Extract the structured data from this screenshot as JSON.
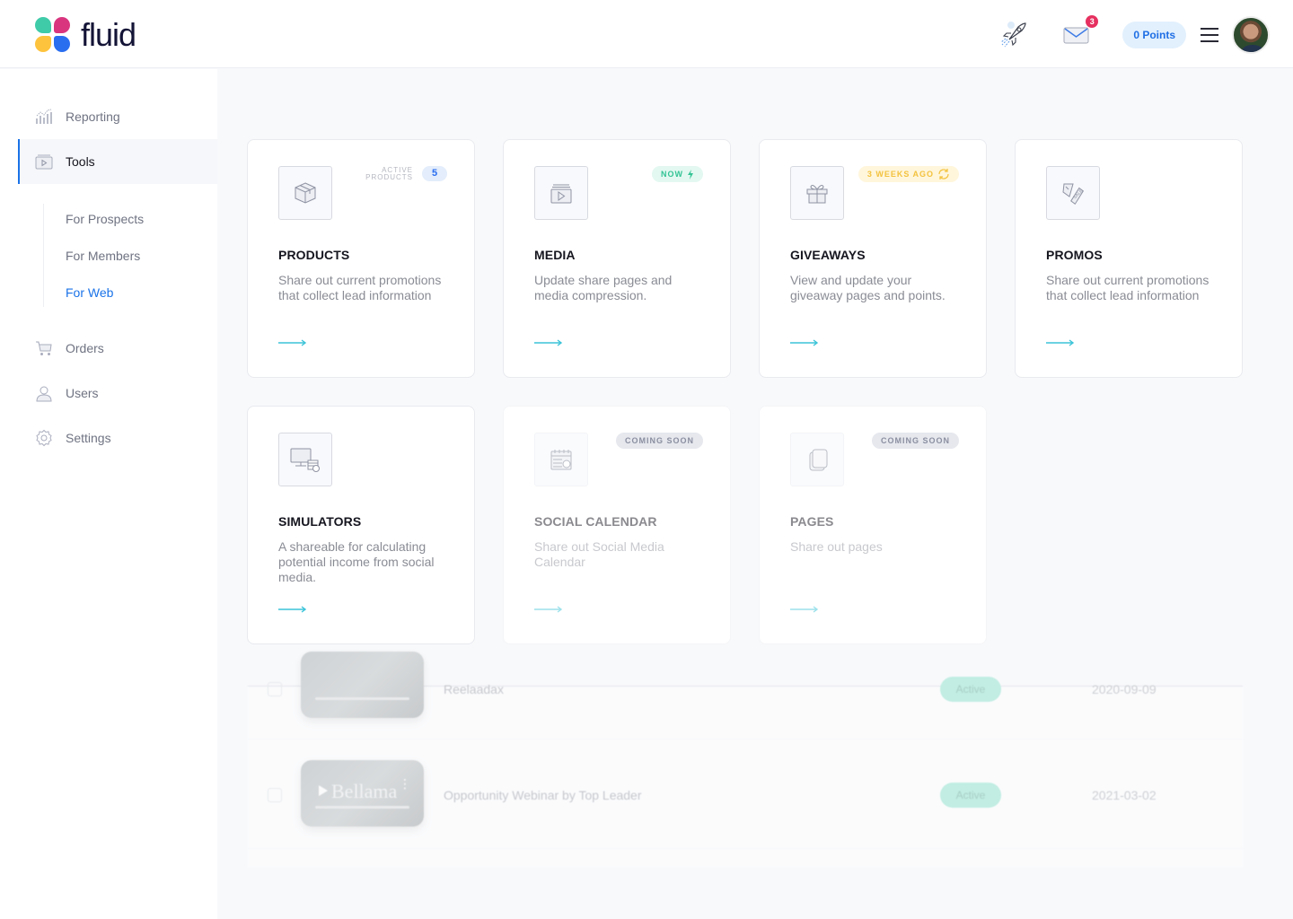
{
  "header": {
    "brand": "fluid",
    "points_label": "0 Points",
    "mail_badge_count": "3",
    "icons": [
      "rocket-icon",
      "mail-icon",
      "hamburger-menu-icon",
      "avatar"
    ]
  },
  "sidebar": {
    "items": [
      {
        "label": "Reporting",
        "icon": "chart-icon",
        "active": false
      },
      {
        "label": "Tools",
        "icon": "media-play-icon",
        "active": true
      },
      {
        "label": "Orders",
        "icon": "cart-icon",
        "active": false
      },
      {
        "label": "Users",
        "icon": "user-icon",
        "active": false
      },
      {
        "label": "Settings",
        "icon": "gear-icon",
        "active": false
      }
    ],
    "sub_items": [
      {
        "label": "For Prospects",
        "active": false
      },
      {
        "label": "For Members",
        "active": false
      },
      {
        "label": "For Web",
        "active": true
      }
    ]
  },
  "cards": [
    {
      "title": "PRODUCTS",
      "desc": "Share out current promotions that collect lead information",
      "icon": "box-icon",
      "badge_caption": "Active Products",
      "badge_value": "5"
    },
    {
      "title": "MEDIA",
      "desc": "Update share pages and media compression.",
      "icon": "media-play-icon",
      "pill": "Now",
      "pill_icon": "lightning-icon"
    },
    {
      "title": "GIVEAWAYS",
      "desc": "View and update your giveaway pages and points.",
      "icon": "gift-icon",
      "pill": "3 Weeks Ago",
      "pill_icon": "refresh-icon"
    },
    {
      "title": "PROMOS",
      "desc": "Share out current promotions that collect lead information",
      "icon": "sale-tag-icon"
    },
    {
      "title": "SIMULATORS",
      "desc": "A shareable for calculating potential income from social media.",
      "icon": "computer-coins-icon"
    },
    {
      "title": "SOCIAL CALENDAR",
      "desc": "Share out Social Media Calendar",
      "icon": "calendar-icon",
      "pill": "Coming Soon",
      "disabled": true
    },
    {
      "title": "PAGES",
      "desc": "Share out pages",
      "icon": "pages-icon",
      "pill": "Coming Soon",
      "disabled": true
    }
  ],
  "table": {
    "rows": [
      {
        "name": "Reelaadax",
        "status": "Active",
        "date": "2020-09-09",
        "thumb_brand": ""
      },
      {
        "name": "Opportunity Webinar by Top Leader",
        "status": "Active",
        "date": "2021-03-02",
        "thumb_brand": "Bellama"
      }
    ]
  },
  "colors": {
    "accent": "#1a73e8",
    "arrow": "#3cc4d8",
    "now": "#33c394",
    "weeks": "#f3c23d",
    "badge_red": "#e6305f"
  }
}
